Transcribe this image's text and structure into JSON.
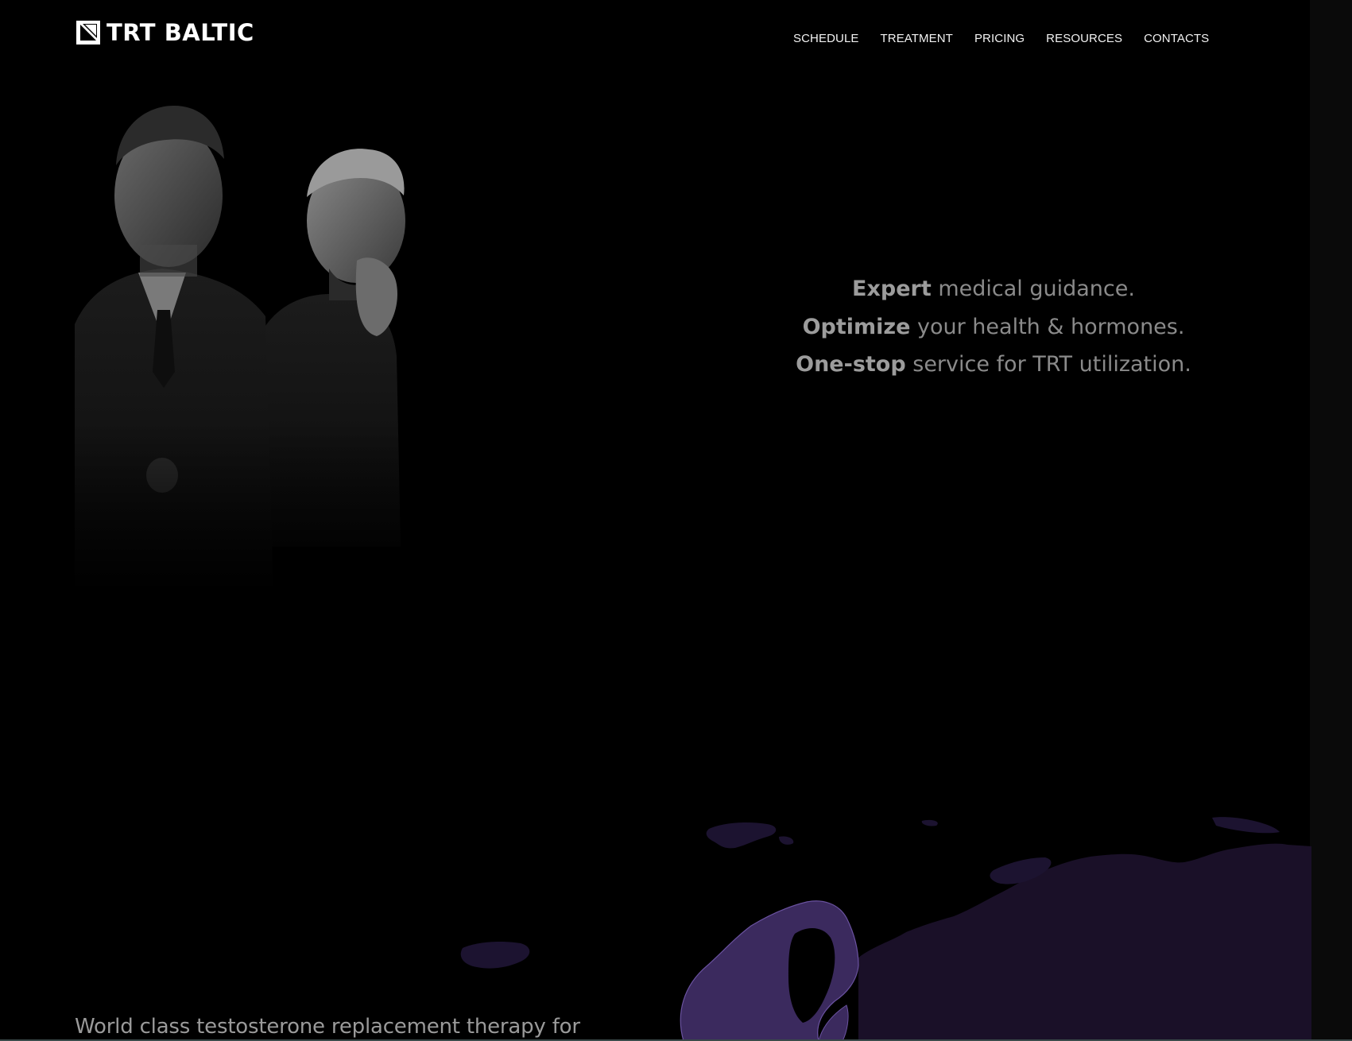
{
  "header": {
    "brand": "TRT BALTIC",
    "logo_icon": "trt-baltic-logo-mark",
    "nav": [
      {
        "label": "SCHEDULE"
      },
      {
        "label": "TREATMENT"
      },
      {
        "label": "PRICING"
      },
      {
        "label": "RESOURCES"
      },
      {
        "label": "CONTACTS"
      }
    ]
  },
  "hero": {
    "photo_subject": "two men in dark clothing, grayscale portrait",
    "taglines": [
      {
        "bold": "Expert",
        "rest": " medical guidance."
      },
      {
        "bold": "Optimize",
        "rest": " your health & hormones."
      },
      {
        "bold": "One-stop",
        "rest": " service for TRT utilization."
      }
    ]
  },
  "map": {
    "region": "Northern Europe",
    "highlight_color": "#3b2a5e",
    "base_color": "#1a1028"
  },
  "intro": {
    "text": "World class testosterone replacement therapy for"
  },
  "colors": {
    "background": "#000000",
    "nav_text": "#f2f2f2",
    "tagline_text": "#8a8a8a"
  }
}
